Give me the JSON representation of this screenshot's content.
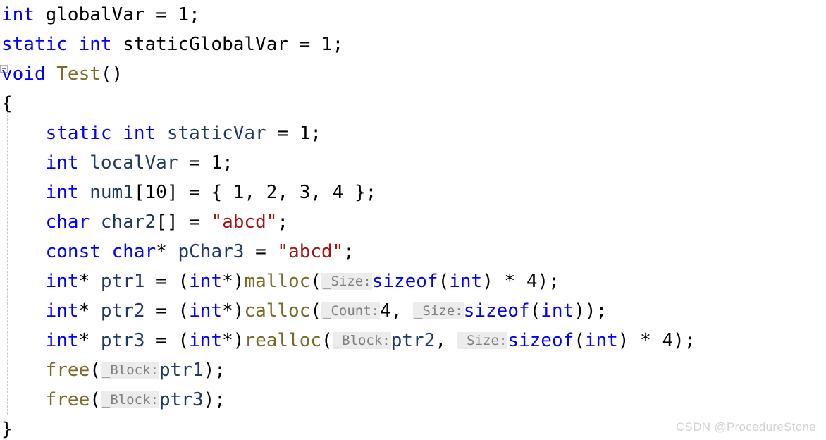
{
  "editor": {
    "language": "C++",
    "background_color": "#ffffff",
    "font_size_px": 26,
    "line_height_px": 42,
    "colors": {
      "keyword": "#0000ff",
      "function": "#7a6a28",
      "local_identifier": "#1f3864",
      "global_identifier": "#000000",
      "string_literal": "#a31515",
      "punctuation": "#000000",
      "hint_text": "#808080",
      "hint_background": "#ececec",
      "indent_guide": "#c8c8c8",
      "watermark": "#d2d2d2"
    }
  },
  "code": {
    "lines": [
      {
        "n": 1,
        "tokens": [
          {
            "t": "kw",
            "v": "int"
          },
          {
            "t": "punct",
            "v": " "
          },
          {
            "t": "gid",
            "v": "globalVar"
          },
          {
            "t": "punct",
            "v": " = "
          },
          {
            "t": "num",
            "v": "1"
          },
          {
            "t": "punct",
            "v": ";"
          }
        ]
      },
      {
        "n": 2,
        "tokens": [
          {
            "t": "kw",
            "v": "static"
          },
          {
            "t": "punct",
            "v": " "
          },
          {
            "t": "kw",
            "v": "int"
          },
          {
            "t": "punct",
            "v": " "
          },
          {
            "t": "gid",
            "v": "staticGlobalVar"
          },
          {
            "t": "punct",
            "v": " = "
          },
          {
            "t": "num",
            "v": "1"
          },
          {
            "t": "punct",
            "v": ";"
          }
        ]
      },
      {
        "n": 3,
        "tokens": [
          {
            "t": "kw",
            "v": "void"
          },
          {
            "t": "punct",
            "v": " "
          },
          {
            "t": "fn",
            "v": "Test"
          },
          {
            "t": "punct",
            "v": "()"
          }
        ]
      },
      {
        "n": 4,
        "tokens": [
          {
            "t": "punct",
            "v": "{"
          }
        ]
      },
      {
        "n": 5,
        "tokens": [
          {
            "t": "punct",
            "v": "    "
          },
          {
            "t": "kw",
            "v": "static"
          },
          {
            "t": "punct",
            "v": " "
          },
          {
            "t": "kw",
            "v": "int"
          },
          {
            "t": "punct",
            "v": " "
          },
          {
            "t": "id",
            "v": "staticVar"
          },
          {
            "t": "punct",
            "v": " = "
          },
          {
            "t": "num",
            "v": "1"
          },
          {
            "t": "punct",
            "v": ";"
          }
        ]
      },
      {
        "n": 6,
        "tokens": [
          {
            "t": "punct",
            "v": "    "
          },
          {
            "t": "kw",
            "v": "int"
          },
          {
            "t": "punct",
            "v": " "
          },
          {
            "t": "id",
            "v": "localVar"
          },
          {
            "t": "punct",
            "v": " = "
          },
          {
            "t": "num",
            "v": "1"
          },
          {
            "t": "punct",
            "v": ";"
          }
        ]
      },
      {
        "n": 7,
        "tokens": [
          {
            "t": "punct",
            "v": "    "
          },
          {
            "t": "kw",
            "v": "int"
          },
          {
            "t": "punct",
            "v": " "
          },
          {
            "t": "id",
            "v": "num1"
          },
          {
            "t": "punct",
            "v": "["
          },
          {
            "t": "num",
            "v": "10"
          },
          {
            "t": "punct",
            "v": "] = { "
          },
          {
            "t": "num",
            "v": "1"
          },
          {
            "t": "punct",
            "v": ", "
          },
          {
            "t": "num",
            "v": "2"
          },
          {
            "t": "punct",
            "v": ", "
          },
          {
            "t": "num",
            "v": "3"
          },
          {
            "t": "punct",
            "v": ", "
          },
          {
            "t": "num",
            "v": "4"
          },
          {
            "t": "punct",
            "v": " };"
          }
        ]
      },
      {
        "n": 8,
        "tokens": [
          {
            "t": "punct",
            "v": "    "
          },
          {
            "t": "kw",
            "v": "char"
          },
          {
            "t": "punct",
            "v": " "
          },
          {
            "t": "id",
            "v": "char2"
          },
          {
            "t": "punct",
            "v": "[] = "
          },
          {
            "t": "str",
            "v": "\"abcd\""
          },
          {
            "t": "punct",
            "v": ";"
          }
        ]
      },
      {
        "n": 9,
        "tokens": [
          {
            "t": "punct",
            "v": "    "
          },
          {
            "t": "kw",
            "v": "const"
          },
          {
            "t": "punct",
            "v": " "
          },
          {
            "t": "kw",
            "v": "char"
          },
          {
            "t": "punct",
            "v": "* "
          },
          {
            "t": "id",
            "v": "pChar3"
          },
          {
            "t": "punct",
            "v": " = "
          },
          {
            "t": "str",
            "v": "\"abcd\""
          },
          {
            "t": "punct",
            "v": ";"
          }
        ]
      },
      {
        "n": 10,
        "tokens": [
          {
            "t": "punct",
            "v": "    "
          },
          {
            "t": "kw",
            "v": "int"
          },
          {
            "t": "punct",
            "v": "* "
          },
          {
            "t": "id",
            "v": "ptr1"
          },
          {
            "t": "punct",
            "v": " = ("
          },
          {
            "t": "kw",
            "v": "int"
          },
          {
            "t": "punct",
            "v": "*)"
          },
          {
            "t": "fn",
            "v": "malloc"
          },
          {
            "t": "punct",
            "v": "("
          },
          {
            "t": "hint",
            "v": "_Size:"
          },
          {
            "t": "kw",
            "v": "sizeof"
          },
          {
            "t": "punct",
            "v": "("
          },
          {
            "t": "kw",
            "v": "int"
          },
          {
            "t": "punct",
            "v": ") * "
          },
          {
            "t": "num",
            "v": "4"
          },
          {
            "t": "punct",
            "v": ");"
          }
        ]
      },
      {
        "n": 11,
        "tokens": [
          {
            "t": "punct",
            "v": "    "
          },
          {
            "t": "kw",
            "v": "int"
          },
          {
            "t": "punct",
            "v": "* "
          },
          {
            "t": "id",
            "v": "ptr2"
          },
          {
            "t": "punct",
            "v": " = ("
          },
          {
            "t": "kw",
            "v": "int"
          },
          {
            "t": "punct",
            "v": "*)"
          },
          {
            "t": "fn",
            "v": "calloc"
          },
          {
            "t": "punct",
            "v": "("
          },
          {
            "t": "hint",
            "v": "_Count:"
          },
          {
            "t": "num",
            "v": "4"
          },
          {
            "t": "punct",
            "v": ", "
          },
          {
            "t": "hint",
            "v": "_Size:"
          },
          {
            "t": "kw",
            "v": "sizeof"
          },
          {
            "t": "punct",
            "v": "("
          },
          {
            "t": "kw",
            "v": "int"
          },
          {
            "t": "punct",
            "v": "));"
          }
        ]
      },
      {
        "n": 12,
        "tokens": [
          {
            "t": "punct",
            "v": "    "
          },
          {
            "t": "kw",
            "v": "int"
          },
          {
            "t": "punct",
            "v": "* "
          },
          {
            "t": "id",
            "v": "ptr3"
          },
          {
            "t": "punct",
            "v": " = ("
          },
          {
            "t": "kw",
            "v": "int"
          },
          {
            "t": "punct",
            "v": "*)"
          },
          {
            "t": "fn",
            "v": "realloc"
          },
          {
            "t": "punct",
            "v": "("
          },
          {
            "t": "hint",
            "v": "_Block:"
          },
          {
            "t": "id",
            "v": "ptr2"
          },
          {
            "t": "punct",
            "v": ", "
          },
          {
            "t": "hint",
            "v": "_Size:"
          },
          {
            "t": "kw",
            "v": "sizeof"
          },
          {
            "t": "punct",
            "v": "("
          },
          {
            "t": "kw",
            "v": "int"
          },
          {
            "t": "punct",
            "v": ") * "
          },
          {
            "t": "num",
            "v": "4"
          },
          {
            "t": "punct",
            "v": ");"
          }
        ]
      },
      {
        "n": 13,
        "tokens": [
          {
            "t": "punct",
            "v": "    "
          },
          {
            "t": "fn",
            "v": "free"
          },
          {
            "t": "punct",
            "v": "("
          },
          {
            "t": "hint",
            "v": "_Block:"
          },
          {
            "t": "id",
            "v": "ptr1"
          },
          {
            "t": "punct",
            "v": ");"
          }
        ]
      },
      {
        "n": 14,
        "tokens": [
          {
            "t": "punct",
            "v": "    "
          },
          {
            "t": "fn",
            "v": "free"
          },
          {
            "t": "punct",
            "v": "("
          },
          {
            "t": "hint",
            "v": "_Block:"
          },
          {
            "t": "id",
            "v": "ptr3"
          },
          {
            "t": "punct",
            "v": ");"
          }
        ]
      },
      {
        "n": 15,
        "tokens": [
          {
            "t": "punct",
            "v": "}"
          }
        ]
      }
    ]
  },
  "watermark": {
    "text": "CSDN @ProcedureStone"
  },
  "gutter": {
    "collapse_marker": "outlining-collapse-box"
  }
}
